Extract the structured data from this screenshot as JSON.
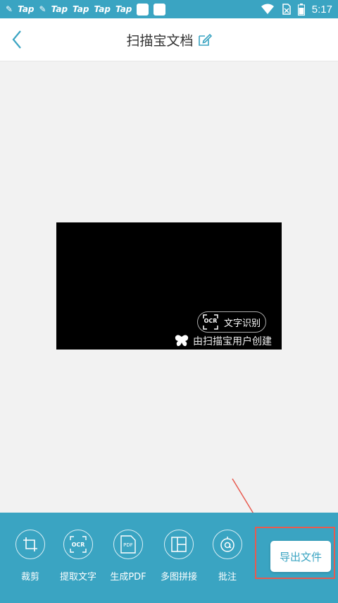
{
  "status_bar": {
    "apps": [
      "Tap",
      "Tap",
      "Tap",
      "Tap",
      "Tap"
    ],
    "time": "5:17"
  },
  "header": {
    "title": "扫描宝文档"
  },
  "document": {
    "ocr_label": "文字识别",
    "ocr_icon_text": "OCR",
    "watermark": "由扫描宝用户创建"
  },
  "toolbar": {
    "crop": "裁剪",
    "extract_text": "提取文字",
    "extract_icon_text": "OCR",
    "pdf": "生成PDF",
    "pdf_icon_text": "PDF",
    "stitch": "多图拼接",
    "annotate": "批注",
    "export": "导出文件"
  },
  "colors": {
    "accent": "#3aa4c2",
    "highlight": "#e85a4f"
  }
}
